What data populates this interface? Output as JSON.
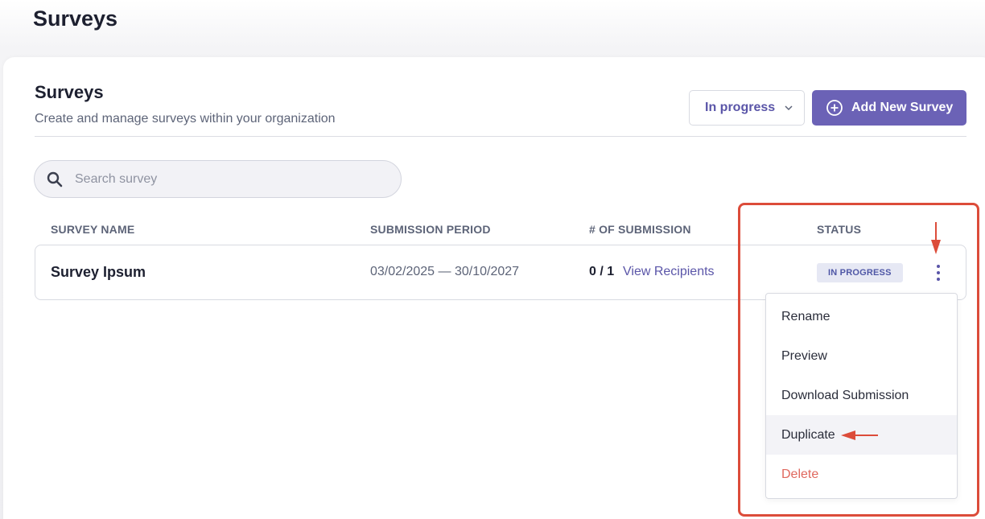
{
  "page": {
    "title": "Surveys"
  },
  "card": {
    "title": "Surveys",
    "subtitle": "Create and manage surveys within your organization"
  },
  "filter": {
    "selected": "In progress",
    "icon": "chevron-down-icon"
  },
  "add_button": {
    "label": "Add New Survey",
    "icon": "plus-circle-icon"
  },
  "search": {
    "placeholder": "Search survey",
    "value": "",
    "icon": "search-icon"
  },
  "table": {
    "headers": [
      "SURVEY NAME",
      "SUBMISSION PERIOD",
      "# OF SUBMISSION",
      "STATUS"
    ],
    "rows": [
      {
        "name": "Survey Ipsum",
        "period": "03/02/2025 — 30/10/2027",
        "submissions": "0 / 1",
        "link": "View Recipients",
        "status": "IN PROGRESS"
      }
    ]
  },
  "menu": {
    "items": [
      {
        "label": "Rename"
      },
      {
        "label": "Preview"
      },
      {
        "label": "Download Submission"
      },
      {
        "label": "Duplicate"
      },
      {
        "label": "Delete"
      }
    ]
  },
  "colors": {
    "accent": "#6b62b6",
    "link": "#5a55a8",
    "danger": "#e0685e",
    "annotation": "#dc4c3a"
  }
}
